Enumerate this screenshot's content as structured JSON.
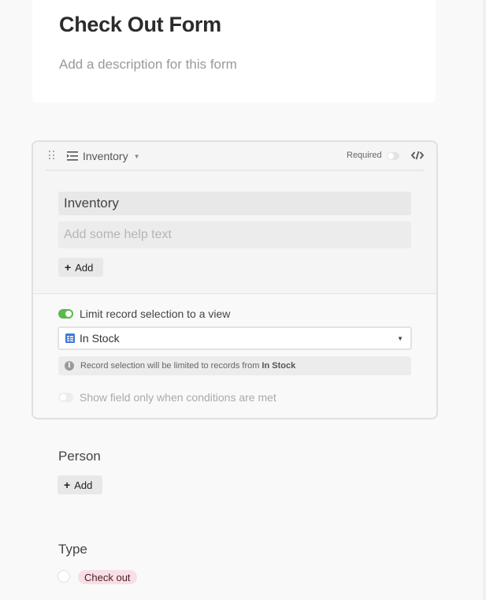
{
  "form": {
    "title": "Check Out Form",
    "description_placeholder": "Add a description for this form"
  },
  "field_card": {
    "field_type_icon": "long-text-lines-icon",
    "field_name": "Inventory",
    "required_label": "Required",
    "required_enabled": false,
    "embed_icon": "code-slash-icon",
    "label_value": "Inventory",
    "help_placeholder": "Add some help text",
    "add_button_label": "Add",
    "limit_toggle_label": "Limit record selection to a view",
    "limit_enabled": true,
    "view_select": {
      "icon": "grid-view-icon",
      "selected": "In Stock"
    },
    "info_text": "Record selection will be limited to records from",
    "info_view": "In Stock",
    "conditions_label": "Show field only when conditions are met",
    "conditions_enabled": false
  },
  "person_field": {
    "label": "Person",
    "add_button_label": "Add"
  },
  "type_field": {
    "label": "Type",
    "options": [
      {
        "label": "Check out",
        "color": "#f7dfe5",
        "selected": false
      }
    ]
  },
  "colors": {
    "toggle_on": "#5cb84b",
    "view_icon": "#3b78d8",
    "pill_background": "#f7dfe5"
  }
}
